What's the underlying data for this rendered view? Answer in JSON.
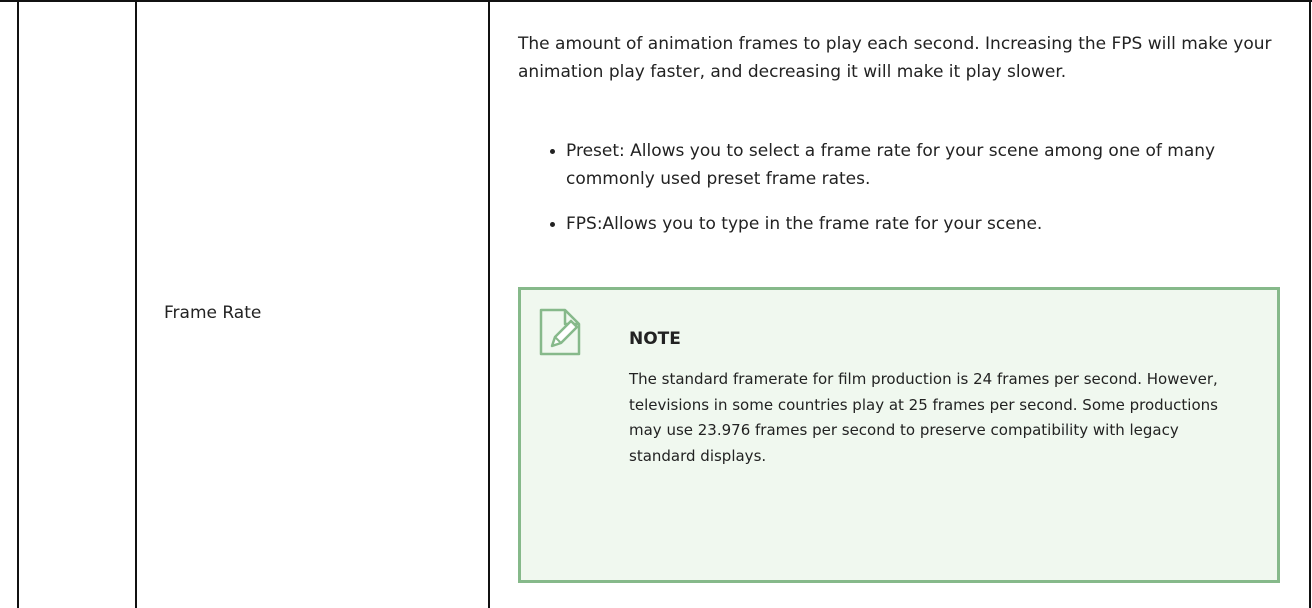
{
  "row": {
    "label": "Frame Rate",
    "description": "The amount of animation frames to play each second. Increasing the FPS will make your animation play faster, and decreasing it will make it play slower.",
    "bullets": [
      {
        "text": "Preset: Allows you to select a frame rate for your scene among one of many commonly used preset frame rates."
      },
      {
        "text": "FPS:Allows you to type in the frame rate for your scene."
      }
    ],
    "note": {
      "icon": "note-edit-icon",
      "title": "NOTE",
      "body": "The standard framerate for film production is 24 frames per second. However, televisions in some countries play at 25 frames per second. Some productions may use 23.976 frames per second to preserve compatibility with legacy standard displays."
    }
  },
  "colors": {
    "note_background": "#f0f8ef",
    "note_border": "#86b98a",
    "table_border": "#111111",
    "text": "#222222"
  }
}
